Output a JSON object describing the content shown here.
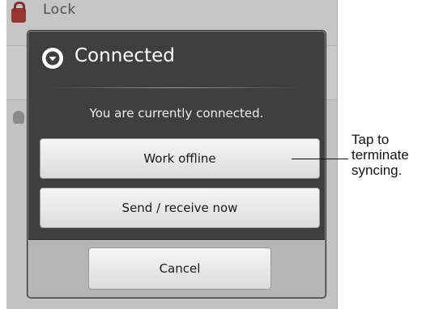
{
  "background": {
    "items": [
      {
        "title": "Lock",
        "icon": "lock-icon"
      },
      {
        "title": "",
        "icon": "person-icon"
      }
    ]
  },
  "dialog": {
    "title": "Connected",
    "icon": "chevron-down-circle-icon",
    "message": "You are currently connected.",
    "buttons": {
      "work_offline": "Work offline",
      "send_receive": "Send / receive now",
      "cancel": "Cancel"
    }
  },
  "callout": {
    "line1": "Tap to",
    "line2": "terminate",
    "line3": "syncing."
  },
  "colors": {
    "dialog_bg": "#3f3f3f",
    "footer_bg": "#b5b5b5",
    "button_bg": "#e8e8e8",
    "lock_icon": "#a33a36"
  }
}
